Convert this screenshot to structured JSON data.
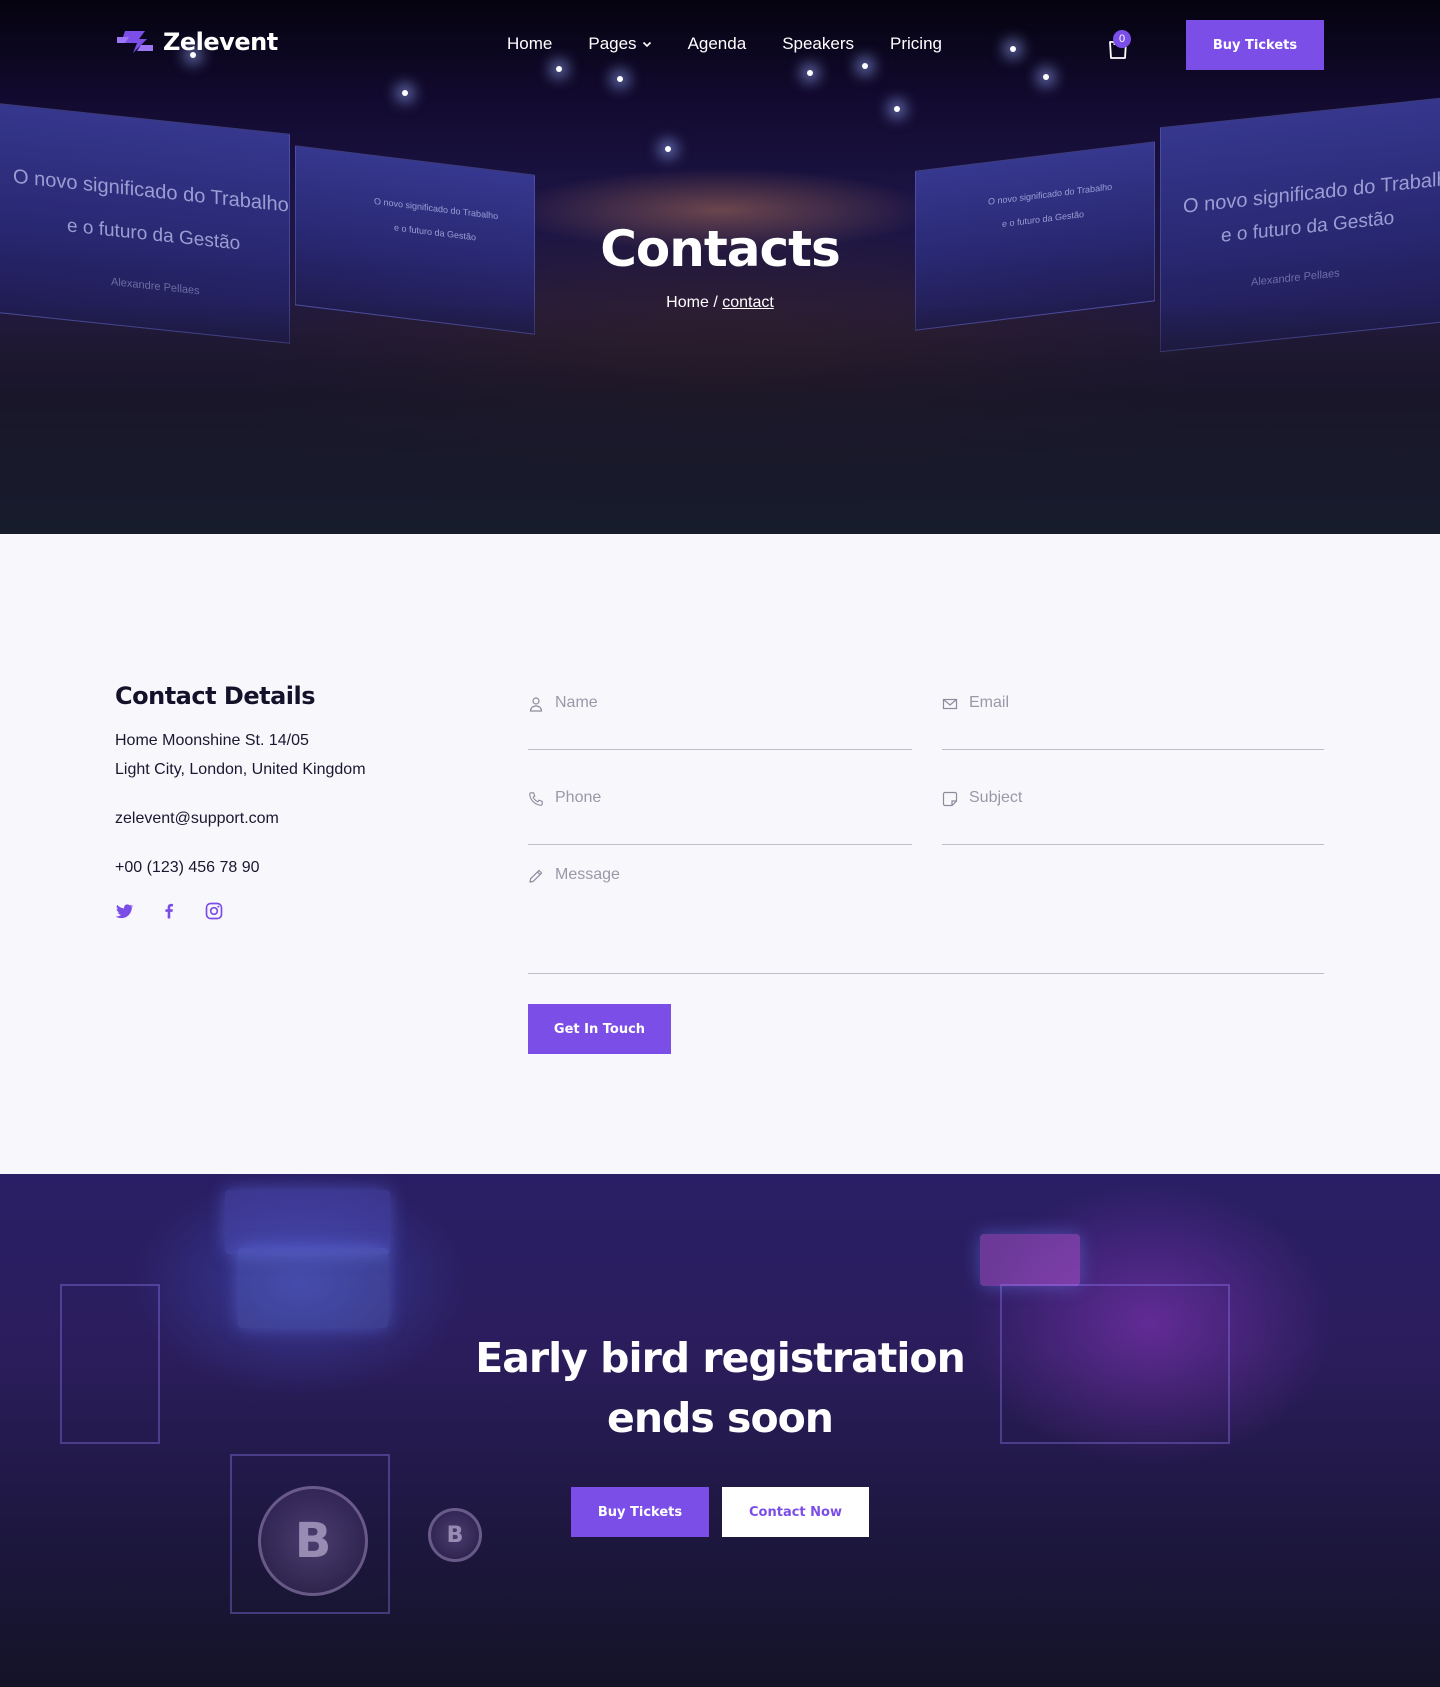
{
  "brand": {
    "name": "Zelevent",
    "accent_color": "#7b4ee8"
  },
  "nav": {
    "items": [
      {
        "label": "Home"
      },
      {
        "label": "Pages"
      },
      {
        "label": "Agenda"
      },
      {
        "label": "Speakers"
      },
      {
        "label": "Pricing"
      }
    ],
    "cart_count": "0",
    "cta_label": "Buy Tickets"
  },
  "hero": {
    "title": "Contacts",
    "breadcrumb_home": "Home",
    "breadcrumb_separator": "/",
    "breadcrumb_current": "contact",
    "screen_text": {
      "line1": "O novo significado do Trabalho",
      "line2": "e o futuro da Gestão",
      "presenter": "Alexandre Pellaes"
    }
  },
  "contact": {
    "title": "Contact Details",
    "address_line1": "Home Moonshine St. 14/05",
    "address_line2": "Light City, London, United Kingdom",
    "email": "zelevent@support.com",
    "phone": "+00 (123) 456 78 90",
    "social": [
      "twitter-icon",
      "facebook-icon",
      "instagram-icon"
    ],
    "form": {
      "name_placeholder": "Name",
      "email_placeholder": "Email",
      "phone_placeholder": "Phone",
      "subject_placeholder": "Subject",
      "message_placeholder": "Message",
      "submit_label": "Get In Touch"
    }
  },
  "cta": {
    "title_line1": "Early bird registration",
    "title_line2": "ends soon",
    "buy_label": "Buy Tickets",
    "contact_label": "Contact Now"
  }
}
